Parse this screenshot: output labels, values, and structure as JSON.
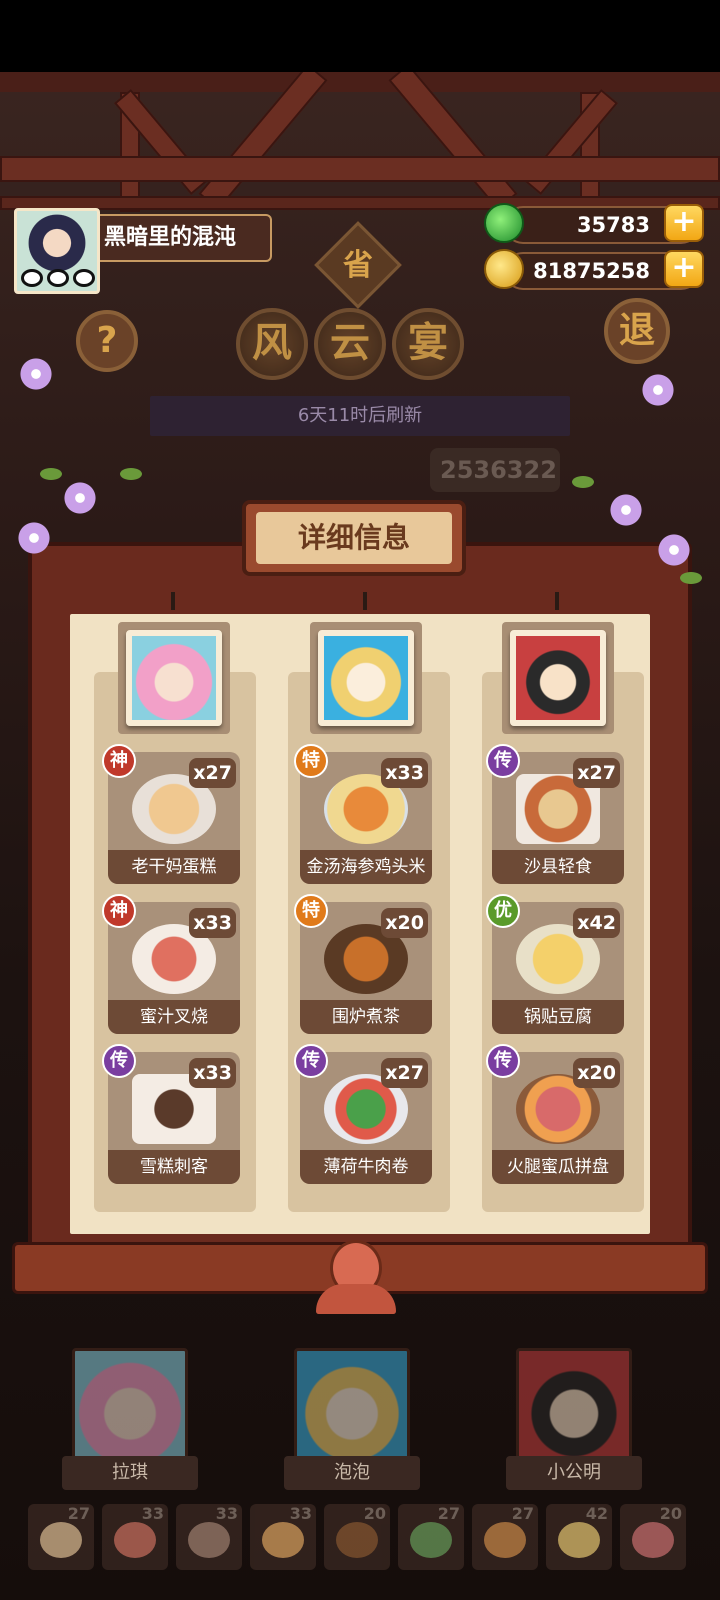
{
  "player": {
    "name": "黑暗里的混沌"
  },
  "currencies": [
    {
      "icon": "jade-icon",
      "value": "35783"
    },
    {
      "icon": "coin-icon",
      "value": "81875258"
    }
  ],
  "buttons": {
    "plus": "+",
    "help": "?",
    "back": "退"
  },
  "title": {
    "badge": "省",
    "chars": [
      "风",
      "云",
      "宴"
    ]
  },
  "refresh_text": "6天11时后刷新",
  "score_partial": "2536322",
  "panel_title": "详细信息",
  "columns": [
    {
      "hero": "拉琪",
      "dishes": [
        {
          "rank": "神",
          "name": "老干妈蛋糕",
          "qty": "x27"
        },
        {
          "rank": "神",
          "name": "蜜汁叉烧",
          "qty": "x33"
        },
        {
          "rank": "传",
          "name": "雪糕刺客",
          "qty": "x33"
        }
      ]
    },
    {
      "hero": "泡泡",
      "dishes": [
        {
          "rank": "特",
          "name": "金汤海参鸡头米",
          "qty": "x33"
        },
        {
          "rank": "特",
          "name": "围炉煮茶",
          "qty": "x20"
        },
        {
          "rank": "传",
          "name": "薄荷牛肉卷",
          "qty": "x27"
        }
      ]
    },
    {
      "hero": "小公明",
      "dishes": [
        {
          "rank": "传",
          "name": "沙县轻食",
          "qty": "x27"
        },
        {
          "rank": "优",
          "name": "锅贴豆腐",
          "qty": "x42"
        },
        {
          "rank": "传",
          "name": "火腿蜜瓜拼盘",
          "qty": "x20"
        }
      ]
    }
  ],
  "mini_dishes": [
    "27",
    "33",
    "33",
    "33",
    "20",
    "27",
    "27",
    "42",
    "20"
  ],
  "colors": {
    "rank_shen": "#c0392b",
    "rank_te": "#e07a1a",
    "rank_chuan": "#7a3ea0",
    "rank_you": "#5a9a2a"
  }
}
